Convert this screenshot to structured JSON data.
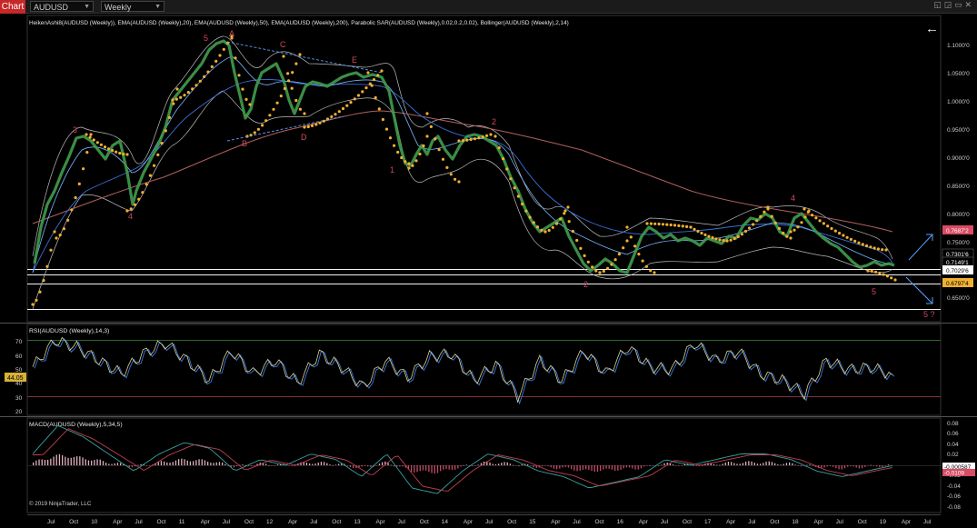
{
  "toolbar": {
    "tab_label": "Chart",
    "instrument": "AUDUSD",
    "timeframe": "Weekly",
    "window_controls": "◱ ◲ ▭ ✕"
  },
  "main_panel": {
    "indicators_label": "HeikenAshi8(AUDUSD (Weekly)), EMA(AUDUSD (Weekly),20), EMA(AUDUSD (Weekly),50), EMA(AUDUSD (Weekly),200), Parabolic SAR(AUDUSD (Weekly),0.02,0.2,0.02), Bollinger(AUDUSD (Weekly),2,14)",
    "y_ticks": [
      "1.1000'0",
      "1.0500'0",
      "1.0000'0",
      "0.9500'0",
      "0.9000'0",
      "0.8500'0",
      "0.8000'0",
      "0.7500'0",
      "0.6500'0"
    ],
    "price_badges": [
      {
        "text": "0.7687'2",
        "bg": "#d94c64",
        "fg": "#ffffff"
      },
      {
        "text": "0.7301'6",
        "bg": "#000000",
        "fg": "#ffffff"
      },
      {
        "text": "0.7149'1",
        "bg": "#000000",
        "fg": "#ffffff"
      },
      {
        "text": "0.7029'6",
        "bg": "#ffffff",
        "fg": "#000000"
      },
      {
        "text": "0.6797'4",
        "bg": "#f0b030",
        "fg": "#000000"
      }
    ],
    "wave_labels": [
      "5",
      "A",
      "C",
      "E",
      "B",
      "D",
      "3",
      "4",
      "1",
      "2",
      "2",
      "4",
      "5",
      "5 ?"
    ],
    "back_arrow": "←"
  },
  "rsi_panel": {
    "label": "RSI(AUDUSD (Weekly),14,3)",
    "y_ticks": [
      "70",
      "60",
      "50",
      "40",
      "30",
      "20"
    ],
    "current_value": "44.05",
    "upper_level": 70,
    "lower_level": 30
  },
  "macd_panel": {
    "label": "MACD(AUDUSD (Weekly),5,34,5)",
    "y_ticks": [
      "0.08",
      "0.06",
      "0.04",
      "0.02",
      "0",
      "-0.02",
      "-0.04",
      "-0.06",
      "-0.08"
    ],
    "value_badges": [
      {
        "text": "-0.000587",
        "bg": "#ffffff",
        "fg": "#000000"
      },
      {
        "text": "-0.0109",
        "bg": "#d94c64",
        "fg": "#ffffff"
      }
    ]
  },
  "copyright": "© 2019 NinjaTrader, LLC",
  "x_axis_labels": [
    "Jul",
    "Oct",
    "10",
    "Apr",
    "Jul",
    "Oct",
    "11",
    "Apr",
    "Jul",
    "Oct",
    "12",
    "Apr",
    "Jul",
    "Oct",
    "13",
    "Apr",
    "Jul",
    "Oct",
    "14",
    "Apr",
    "Jul",
    "Oct",
    "15",
    "Apr",
    "Jul",
    "Oct",
    "16",
    "Apr",
    "Jul",
    "Oct",
    "17",
    "Apr",
    "Jul",
    "Oct",
    "18",
    "Apr",
    "Jul",
    "Oct",
    "19",
    "Apr",
    "Jul"
  ],
  "chart_data": [
    {
      "type": "line",
      "title": "AUDUSD Weekly",
      "ylim": [
        0.6,
        1.125
      ],
      "series": [
        {
          "name": "HeikenAshi8(AUDUSD (Weekly))",
          "values": [
            0.69,
            0.83,
            0.93,
            0.91,
            0.82,
            0.94,
            1.0,
            1.07,
            1.1,
            0.99,
            1.06,
            0.98,
            1.04,
            1.04,
            1.06,
            1.04,
            0.89,
            0.93,
            0.94,
            0.93,
            0.94,
            0.85,
            0.76,
            0.72,
            0.71,
            0.75,
            0.76,
            0.74,
            0.77,
            0.8,
            0.8,
            0.79,
            0.75,
            0.72,
            0.71
          ]
        },
        {
          "name": "EMA 200",
          "values": [
            0.78,
            0.8,
            0.83,
            0.86,
            0.88,
            0.9,
            0.92,
            0.94,
            0.96,
            0.98,
            0.99,
            1.0,
            1.0,
            0.98,
            0.96,
            0.95,
            0.94,
            0.93,
            0.92,
            0.9,
            0.88,
            0.86,
            0.84,
            0.82,
            0.81,
            0.8,
            0.79,
            0.78,
            0.77
          ]
        }
      ]
    },
    {
      "type": "line",
      "title": "RSI(AUDUSD (Weekly),14,3)",
      "ylim": [
        15,
        80
      ],
      "values": [
        50,
        70,
        65,
        55,
        45,
        60,
        68,
        55,
        40,
        62,
        45,
        55,
        38,
        60,
        50,
        35,
        55,
        42,
        58,
        60,
        40,
        52,
        28,
        55,
        40,
        62,
        45,
        65,
        50,
        48,
        68,
        55,
        62,
        45,
        40,
        30,
        55,
        48,
        50,
        44
      ]
    },
    {
      "type": "bar",
      "title": "MACD(AUDUSD (Weekly),5,34,5)",
      "ylim": [
        -0.08,
        0.08
      ],
      "values": [
        0.02,
        0.07,
        0.05,
        0.02,
        -0.01,
        0.02,
        0.04,
        0.03,
        -0.01,
        0.01,
        0.0,
        0.02,
        0.01,
        -0.02,
        0.02,
        -0.04,
        -0.05,
        -0.01,
        0.02,
        0.01,
        -0.01,
        -0.02,
        -0.04,
        -0.03,
        -0.02,
        0.01,
        0.0,
        0.01,
        0.02,
        0.02,
        0.01,
        -0.01,
        -0.02,
        -0.01,
        -0.0006
      ]
    }
  ]
}
